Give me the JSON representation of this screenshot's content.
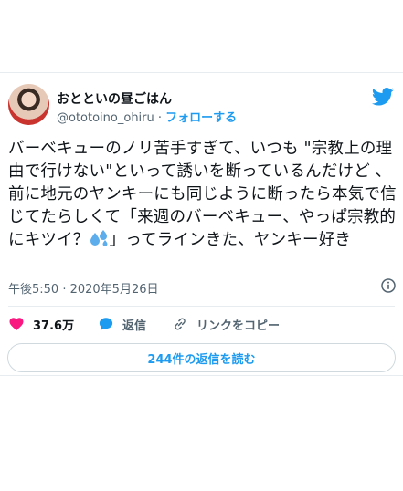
{
  "author": {
    "display_name": "おとといの昼ごはん",
    "handle": "@ototoino_ohiru",
    "separator": "·",
    "follow_label": "フォローする"
  },
  "tweet": {
    "text": "バーベキューのノリ苦手すぎて、いつも \"宗教上の理由で行けない\"といって誘いを断っているんだけど 、前に地元のヤンキーにも同じように断ったら本気で信じてたらしくて「来週のバーベキュー、やっぱ宗教的にキツイ？",
    "text_after_emoji": "」ってラインきた、ヤンキー好き",
    "emoji": "sweat-droplets-emoji",
    "timestamp": "午後5:50 · 2020年5月26日"
  },
  "actions": {
    "likes_count": "37.6万",
    "reply_label": "返信",
    "copy_link_label": "リンクをコピー"
  },
  "replies_button_label": "244件の返信を読む",
  "icons": {
    "brand": "twitter-bird-icon",
    "info": "info-icon",
    "like": "heart-icon",
    "reply": "speech-bubble-icon",
    "link": "link-icon"
  },
  "colors": {
    "accent": "#1d9bf0",
    "like": "#f91880",
    "text": "#0f1419",
    "muted": "#536471",
    "border": "#cfd9de"
  }
}
